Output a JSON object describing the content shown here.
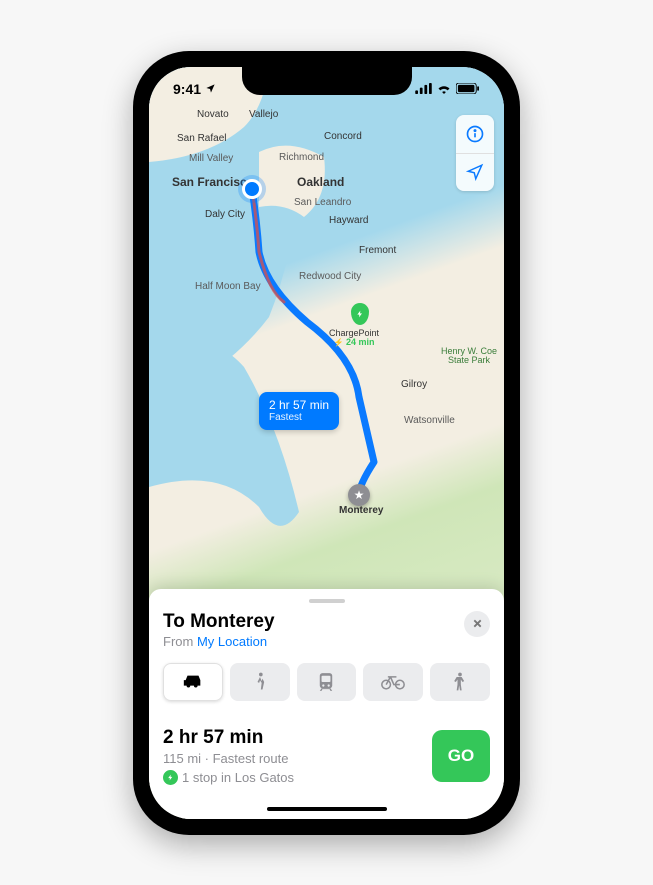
{
  "statusbar": {
    "time": "9:41"
  },
  "map": {
    "cities": {
      "novato": "Novato",
      "vallejo": "Vallejo",
      "san_rafael": "San Rafael",
      "mill_valley": "Mill Valley",
      "concord": "Concord",
      "richmond": "Richmond",
      "san_francisco": "San Francisco",
      "oakland": "Oakland",
      "san_leandro": "San Leandro",
      "daly_city": "Daly City",
      "hayward": "Hayward",
      "fremont": "Fremont",
      "half_moon_bay": "Half Moon Bay",
      "redwood_city": "Redwood City",
      "gilroy": "Gilroy",
      "watsonville": "Watsonville",
      "monterey": "Monterey"
    },
    "parks": {
      "henry_coe": "Henry W. Coe\nState Park"
    },
    "charge_station": {
      "name": "ChargePoint",
      "wait": "24 min"
    },
    "route_badge": {
      "time": "2 hr 57 min",
      "label": "Fastest"
    },
    "controls": {
      "info": "info-icon",
      "locate": "location-icon"
    }
  },
  "sheet": {
    "title": "To Monterey",
    "from_prefix": "From ",
    "from_link": "My Location",
    "modes": {
      "drive": "car-icon",
      "walk": "walk-icon",
      "transit": "transit-icon",
      "bike": "bike-icon",
      "rideshare": "rideshare-icon"
    },
    "route": {
      "time": "2 hr 57 min",
      "detail": "115 mi · Fastest route",
      "stop": "1 stop in Los Gatos"
    },
    "go_label": "GO"
  }
}
